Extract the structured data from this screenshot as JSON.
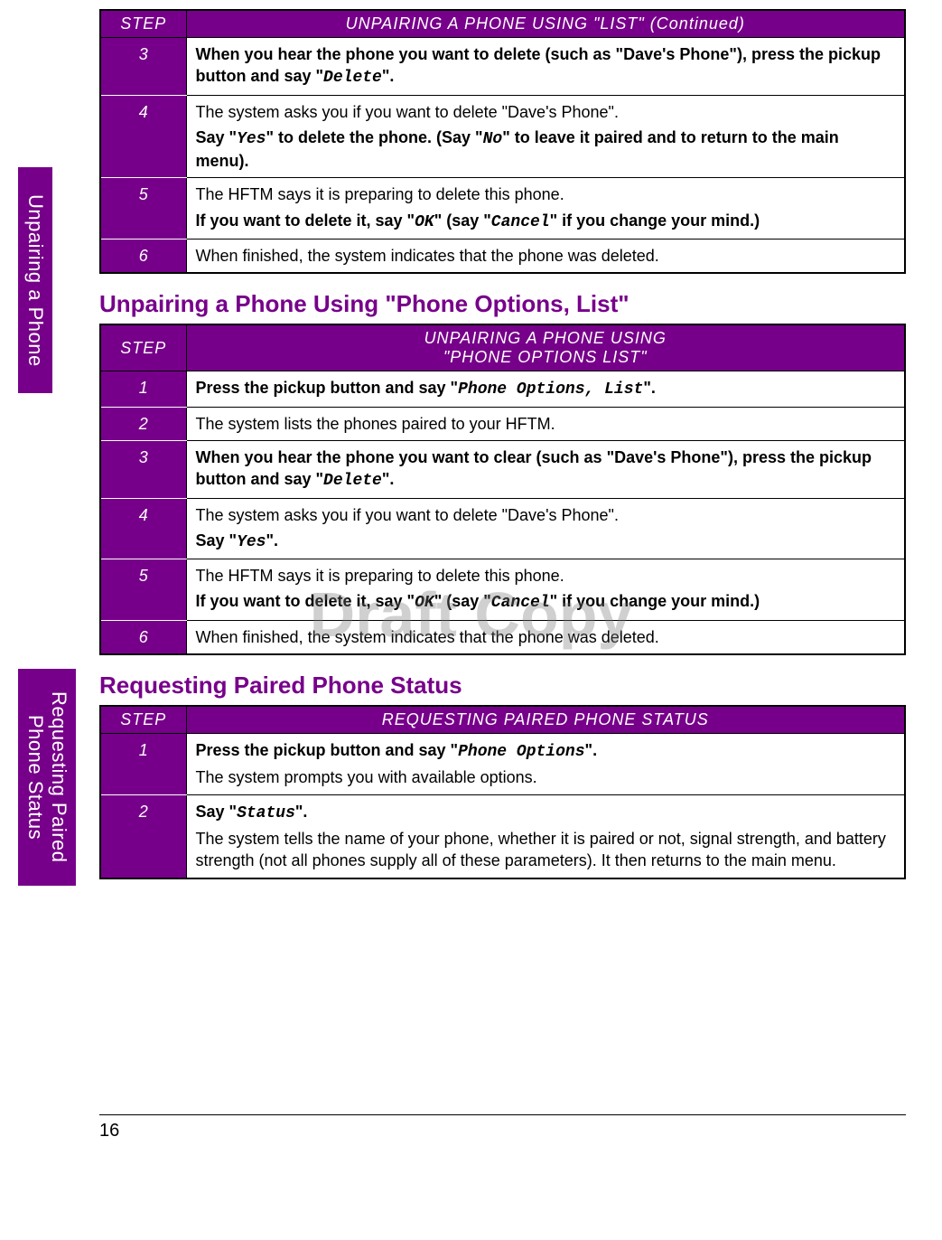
{
  "sideTabs": {
    "unpairing": "Unpairing a Phone",
    "requesting_l1": "Requesting Paired",
    "requesting_l2": "Phone Status"
  },
  "watermark": "Draft Copy",
  "pageNumber": "16",
  "table1": {
    "stepHeader": "STEP",
    "title": "UNPAIRING A PHONE USING \"LIST\" (Continued)",
    "rows": {
      "r3": {
        "num": "3",
        "t1a": "When you hear the phone you want to delete (such as \"Dave's Phone\"), press the pickup button and say \"",
        "cmd1": "Delete",
        "t1b": "\"."
      },
      "r4": {
        "num": "4",
        "t1": "The system asks you if you want to delete \"Dave's Phone\".",
        "t2a": "Say \"",
        "cmd2a": "Yes",
        "t2b": "\" to delete the phone. (Say \"",
        "cmd2b": "No",
        "t2c": "\" to leave it paired and to return to the main menu)."
      },
      "r5": {
        "num": "5",
        "t1": "The HFTM says it is preparing to delete this phone.",
        "t2a": "If you want to delete it, say \"",
        "cmd2a": "OK",
        "t2b": "\" (say \"",
        "cmd2b": "Cancel",
        "t2c": "\" if you change your mind.)"
      },
      "r6": {
        "num": "6",
        "t1": "When finished, the system indicates that the phone was deleted."
      }
    }
  },
  "section2": "Unpairing a Phone Using \"Phone Options, List\"",
  "table2": {
    "stepHeader": "STEP",
    "titleL1": "UNPAIRING A PHONE USING",
    "titleL2": "\"PHONE OPTIONS LIST\"",
    "rows": {
      "r1": {
        "num": "1",
        "t1a": "Press the pickup button and say \"",
        "cmd1": "Phone Options, List",
        "t1b": "\"."
      },
      "r2": {
        "num": "2",
        "t1": "The system lists the phones paired to your HFTM."
      },
      "r3": {
        "num": "3",
        "t1a": "When you hear the phone you want to clear (such as \"Dave's Phone\"), press the pickup button and say \"",
        "cmd1": "Delete",
        "t1b": "\"."
      },
      "r4": {
        "num": "4",
        "t1": "The system asks you if you want to delete \"Dave's Phone\".",
        "t2a": "Say \"",
        "cmd2a": "Yes",
        "t2b": "\"."
      },
      "r5": {
        "num": "5",
        "t1": "The HFTM says it is preparing to delete this phone.",
        "t2a": "If you want to delete it, say \"",
        "cmd2a": "OK",
        "t2b": "\" (say \"",
        "cmd2b": "Cancel",
        "t2c": "\" if you change your mind.)"
      },
      "r6": {
        "num": "6",
        "t1": "When finished, the system indicates that the phone was deleted."
      }
    }
  },
  "section3": "Requesting Paired Phone Status",
  "table3": {
    "stepHeader": "STEP",
    "title": "REQUESTING PAIRED PHONE STATUS",
    "rows": {
      "r1": {
        "num": "1",
        "t1a": "Press the pickup button and say \"",
        "cmd1": "Phone Options",
        "t1b": "\".",
        "t2": "The system prompts you with available options."
      },
      "r2": {
        "num": "2",
        "t1a": "Say \"",
        "cmd1": "Status",
        "t1b": "\".",
        "t2": "The system tells the name of your phone, whether it is paired or not, signal strength, and battery strength (not all phones supply all of these parameters). It then returns to the main menu."
      }
    }
  }
}
